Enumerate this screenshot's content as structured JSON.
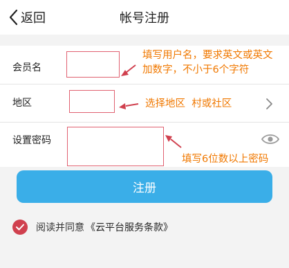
{
  "header": {
    "back_label": "返回",
    "title": "帐号注册"
  },
  "form": {
    "username_label": "会员名",
    "region_label": "地区",
    "password_label": "设置密码"
  },
  "hints": {
    "username_line1": "填写用户名，要求英文或英文",
    "username_line2": "加数字，不小于6个字符",
    "region": "选择地区  村或社区",
    "password": "填写6位数以上密码"
  },
  "submit_label": "注册",
  "agreement": {
    "text": "阅读并同意",
    "link": "《云平台服务条款》"
  },
  "colors": {
    "accent": "#3aaee8",
    "annotation": "#f07800",
    "highlight_box": "#e06070",
    "check": "#d0404e"
  }
}
